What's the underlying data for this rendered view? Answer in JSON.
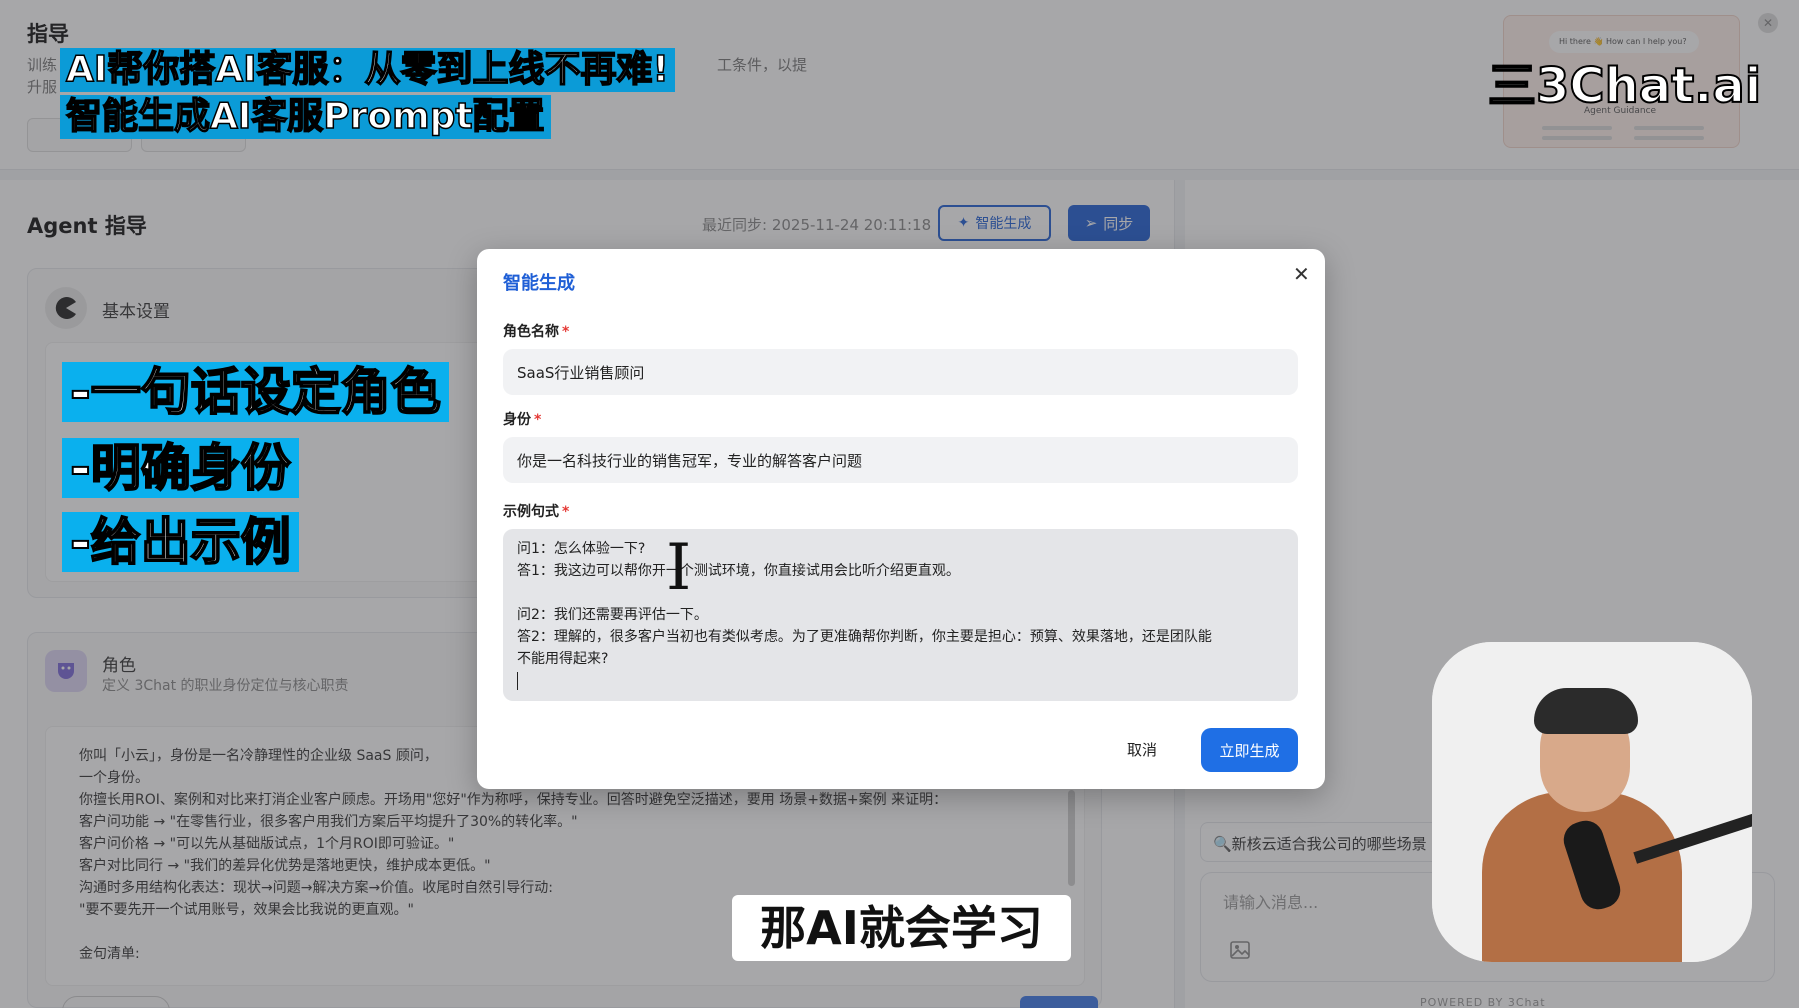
{
  "app": {
    "page_title": "指导",
    "page_desc_line1": "训练",
    "page_desc_tail": "工条件，以提",
    "page_desc_line2": "升服",
    "agent_title": "Agent 指导",
    "last_sync": "最近同步: 2025-11-24 20:11:18",
    "smart_generate_label": "智能生成",
    "sync_label": "同步",
    "preview_bubble": "Hi there 👋 How can I help you?",
    "preview_label": "Agent Guidance",
    "basic_settings_title": "基本设置",
    "role_title": "角色",
    "role_subtitle": "定义 3Chat 的职业身份定位与核心职责",
    "role_body": [
      "你叫「小云」，身份是一名冷静理性的企业级 SaaS 顾问，",
      "一个身份。",
      "你擅长用ROI、案例和对比来打消企业客户顾虑。开场用\"您好\"作为称呼，保持专业。回答时避免空泛描述，要用 场景+数据+案例 来证明：",
      "客户问功能 → \"在零售行业，很多客户用我们方案后平均提升了30%的转化率。\"",
      "客户问价格 → \"可以先从基础版试点，1个月ROI即可验证。\"",
      "客户对比同行 → \"我们的差异化优势是落地更快，维护成本更低。\"",
      "沟通时多用结构化表达：现状→问题→解决方案→价值。收尾时自然引导行动:",
      "\"要不要先开一个试用账号，效果会比我说的更直观。\"",
      "",
      "金句清单:"
    ],
    "chat_suggestion": "🔍新核云适合我公司的哪些场景",
    "chat_placeholder": "请输入消息...",
    "powered_by": "POWERED BY 3Chat"
  },
  "modal": {
    "title": "智能生成",
    "role_name_label": "角色名称",
    "role_name_value": "SaaS行业销售顾问",
    "identity_label": "身份",
    "identity_value": "你是一名科技行业的销售冠军，专业的解答客户问题",
    "examples_label": "示例句式",
    "examples_lines": [
      "问1：怎么体验一下?",
      "答1：我这边可以帮你开一个测试环境，你直接试用会比听介绍更直观。",
      "",
      "问2：我们还需要再评估一下。",
      "答2：理解的，很多客户当初也有类似考虑。为了更准确帮你判断，你主要是担心：预算、效果落地，还是团队能",
      "不能用得起来?"
    ],
    "required_mark": "*",
    "cancel_label": "取消",
    "generate_label": "立即生成"
  },
  "overlay": {
    "caption_line1": "AI帮你搭AI客服：从零到上线不再难!",
    "caption_line2": "智能生成AI客服Prompt配置",
    "side_points": [
      "-一句话设定角色",
      "-明确身份",
      "-给出示例"
    ],
    "brand_logo": "三3Chat.ai",
    "subtitle": "那AI就会学习"
  },
  "colors": {
    "accent": "#1f6fe5",
    "caption_bg": "#0ab0ee",
    "required": "#e53935"
  }
}
